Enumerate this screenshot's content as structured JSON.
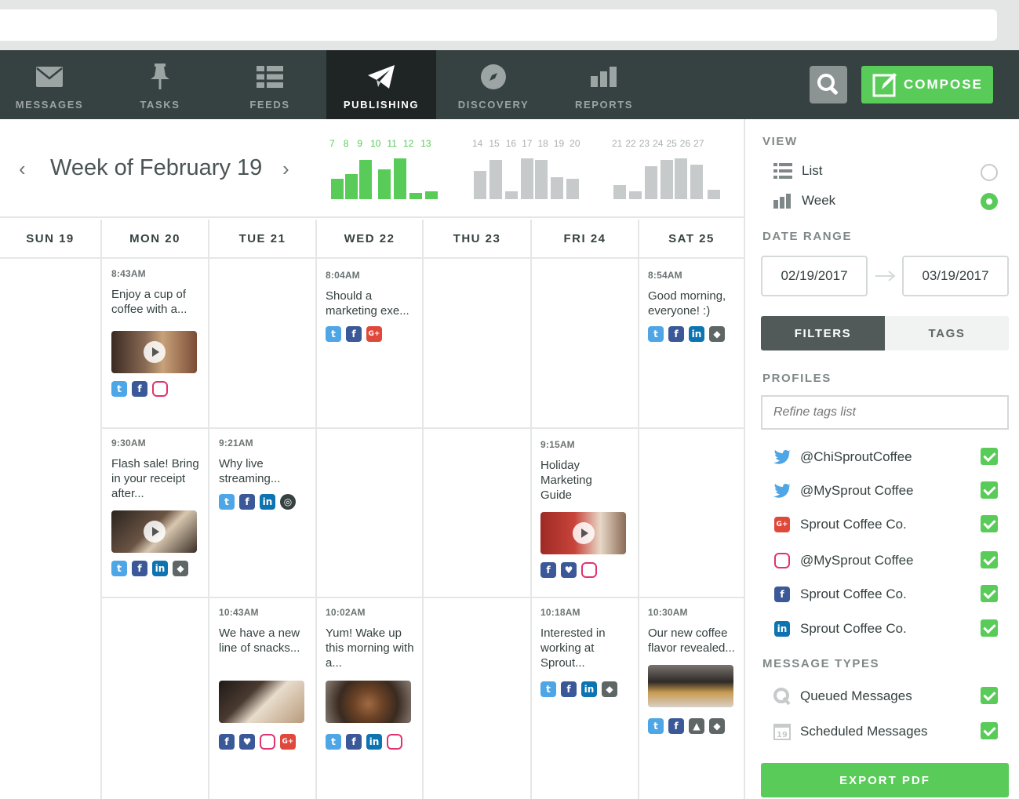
{
  "nav": {
    "messages": "MESSAGES",
    "tasks": "TASKS",
    "feeds": "FEEDS",
    "publishing": "PUBLISHING",
    "discovery": "DISCOVERY",
    "reports": "REPORTS",
    "compose": "COMPOSE"
  },
  "week": {
    "title": "Week of February 19",
    "spark1": [
      "7",
      "8",
      "9",
      "10",
      "11",
      "12",
      "13"
    ],
    "spark2": [
      "14",
      "15",
      "16",
      "17",
      "18",
      "19",
      "20"
    ],
    "spark3": [
      "21",
      "22",
      "23",
      "24",
      "25",
      "26",
      "27"
    ]
  },
  "days": [
    "SUN 19",
    "MON 20",
    "TUE 21",
    "WED 22",
    "THU 23",
    "FRI 24",
    "SAT 25"
  ],
  "posts": {
    "mon1": {
      "time": "8:43AM",
      "text": "Enjoy a cup of coffee with a..."
    },
    "wed1": {
      "time": "8:04AM",
      "text": "Should a marketing exe..."
    },
    "sat1": {
      "time": "8:54AM",
      "text": "Good morning, everyone! :)"
    },
    "mon2": {
      "time": "9:30AM",
      "text": "Flash sale! Bring in your receipt after..."
    },
    "tue2": {
      "time": "9:21AM",
      "text": "Why live streaming..."
    },
    "fri2": {
      "time": "9:15AM",
      "text": "Holiday Marketing Guide"
    },
    "tue3": {
      "time": "10:43AM",
      "text": "We have a new line of snacks..."
    },
    "wed3": {
      "time": "10:02AM",
      "text": "Yum! Wake up this morning with a..."
    },
    "fri3": {
      "time": "10:18AM",
      "text": "Interested in working at Sprout..."
    },
    "sat3": {
      "time": "10:30AM",
      "text": "Our new coffee flavor revealed..."
    }
  },
  "panel": {
    "view_label": "VIEW",
    "view_list": "List",
    "view_week": "Week",
    "date_range_label": "DATE RANGE",
    "date_start": "02/19/2017",
    "date_end": "03/19/2017",
    "tab_filters": "FILTERS",
    "tab_tags": "TAGS",
    "profiles_label": "PROFILES",
    "refine_placeholder": "Refine tags list",
    "profiles": [
      "@ChiSproutCoffee",
      "@MySprout Coffee",
      "Sprout Coffee Co.",
      "@MySprout Coffee",
      "Sprout Coffee Co.",
      "Sprout Coffee Co."
    ],
    "message_types_label": "MESSAGE TYPES",
    "queued": "Queued Messages",
    "scheduled": "Scheduled Messages",
    "export": "EXPORT PDF"
  },
  "colors": {
    "accent": "#59cb59",
    "nav_bg": "#364141",
    "nav_active": "#1f2525"
  }
}
